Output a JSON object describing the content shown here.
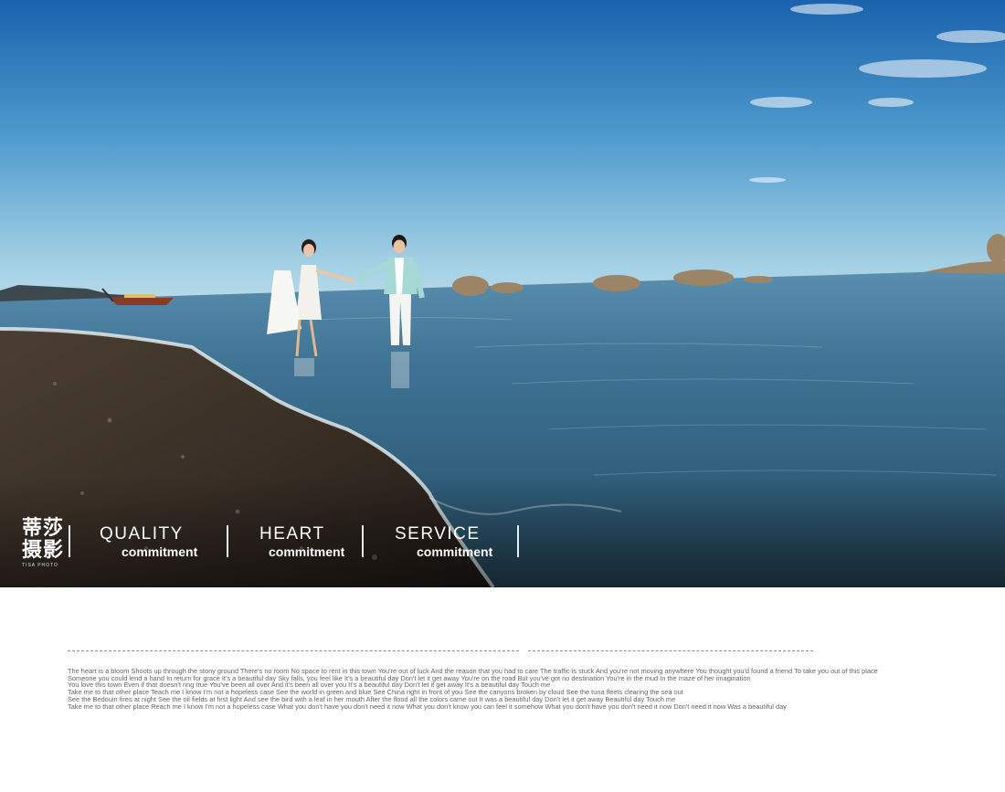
{
  "brand": {
    "logo_text": "蒂莎摄影",
    "sub_text": "TISA PHOTO"
  },
  "pillars": [
    {
      "title": "QUALITY",
      "subtitle": "commitment"
    },
    {
      "title": "HEART",
      "subtitle": "commitment"
    },
    {
      "title": "SERVICE",
      "subtitle": "commitment"
    }
  ],
  "lyrics": [
    "The heart is a bloom Shoots up through the stony ground There's no room No space to rent in this town You're out of luck And the reason that you had to care The traffic is stuck And you're not moving anywhere  You thought you'd found a friend To take you out of this place",
    "Someone you could lend a hand In return for grace It's a beautiful day  Sky falls, you feel like It's a beautiful day Don't let it get away  You're on the road But you've got no destination  You're in the mud In the maze of her imagination",
    "You love this town Even if that doesn't ring true  You've been all over And it's been all over you It's a beautiful day  Don't let it get away It's a beautiful day Touch me",
    "Take me to that other place Teach me I know I'm not a hopeless case  See the world in green and blue See  China right in front of you  See the canyons broken by cloud See the tuna fleets clearing the sea out",
    "See the Bedouin fires at night See the oil fields at first light And see the bird with a leaf in her mouth After the  flood all the colors came out It was a beautiful day Don't let it get away Beautiful day Touch me",
    "Take me to that other place  Reach me I know I'm not a hopeless case  What you don't have you don't need it now What you don't know you can feel it somehow  What you don't have you don't need it now Don't need it now Was a beautiful day"
  ],
  "colors": {
    "sky_top": "#1f6fb8",
    "sky_horizon": "#a9d3e6",
    "sea": "#3e7393",
    "sand": "#3a2f26",
    "overlay_text": "#ffffff",
    "body_text": "#666666"
  }
}
